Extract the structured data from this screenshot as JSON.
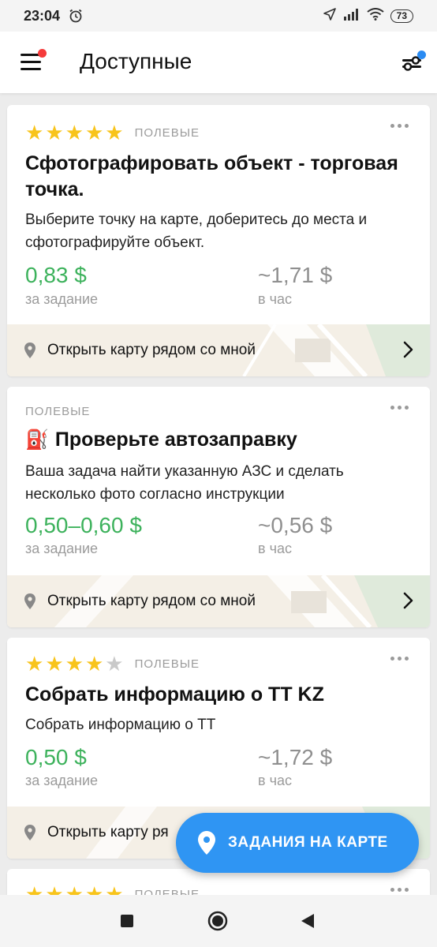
{
  "status_bar": {
    "time": "23:04",
    "battery": "73"
  },
  "header": {
    "title": "Доступные"
  },
  "cards": [
    {
      "rating": 5,
      "category": "ПОЛЕВЫЕ",
      "title": "Сфотографировать объект - торговая точка.",
      "description": "Выберите точку на карте, доберитесь до места и сфотографируйте объект.",
      "price": "0,83 $",
      "price_label": "за задание",
      "hourly": "~1,71 $",
      "hourly_label": "в час",
      "map_link": "Открыть карту рядом со мной"
    },
    {
      "category": "ПОЛЕВЫЕ",
      "emoji": "⛽",
      "title": "Проверьте автозаправку",
      "description": "Ваша задача найти указанную АЗС и сделать несколько фото согласно инструкции",
      "price": "0,50–0,60 $",
      "price_label": "за задание",
      "hourly": "~0,56 $",
      "hourly_label": "в час",
      "map_link": "Открыть карту рядом со мной"
    },
    {
      "rating": 4,
      "category": "ПОЛЕВЫЕ",
      "title": "Собрать информацию о ТТ KZ",
      "description": "Собрать информацию о ТТ",
      "price": "0,50 $",
      "price_label": "за задание",
      "hourly": "~1,72 $",
      "hourly_label": "в час",
      "map_link": "Открыть карту ря"
    },
    {
      "rating": 5,
      "category": "ПОЛЕВЫЕ"
    }
  ],
  "fab": {
    "label": "ЗАДАНИЯ НА КАРТЕ",
    "icon": "map-pin-icon"
  },
  "colors": {
    "price_green": "#3db25c",
    "accent_blue": "#2f95f3",
    "star_yellow": "#f8c41b",
    "badge_red": "#f53b3b"
  }
}
